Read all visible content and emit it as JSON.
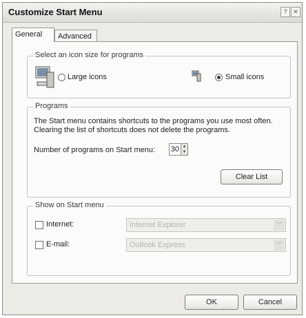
{
  "window": {
    "title": "Customize Start Menu",
    "help_glyph": "?",
    "close_glyph": "✕"
  },
  "tabs": [
    {
      "label": "General",
      "selected": true
    },
    {
      "label": "Advanced",
      "selected": false
    }
  ],
  "icon_size_group": {
    "legend": "Select an icon size for programs",
    "large_label": "Large icons",
    "small_label": "Small icons",
    "selected": "small",
    "large_icon": "large-computer-icon",
    "small_icon": "small-computer-icon"
  },
  "programs_group": {
    "legend": "Programs",
    "description": "The Start menu contains shortcuts to the programs you use most often. Clearing the list of shortcuts does not delete the programs.",
    "number_label": "Number of programs on Start menu:",
    "number_value": "30",
    "clear_button": "Clear List"
  },
  "show_group": {
    "legend": "Show on Start menu",
    "internet_label": "Internet:",
    "internet_value": "Internet Explorer",
    "email_label": "E-mail:",
    "email_value": "Outlook Express",
    "internet_checked": false,
    "email_checked": false
  },
  "footer": {
    "ok_label": "OK",
    "cancel_label": "Cancel"
  }
}
